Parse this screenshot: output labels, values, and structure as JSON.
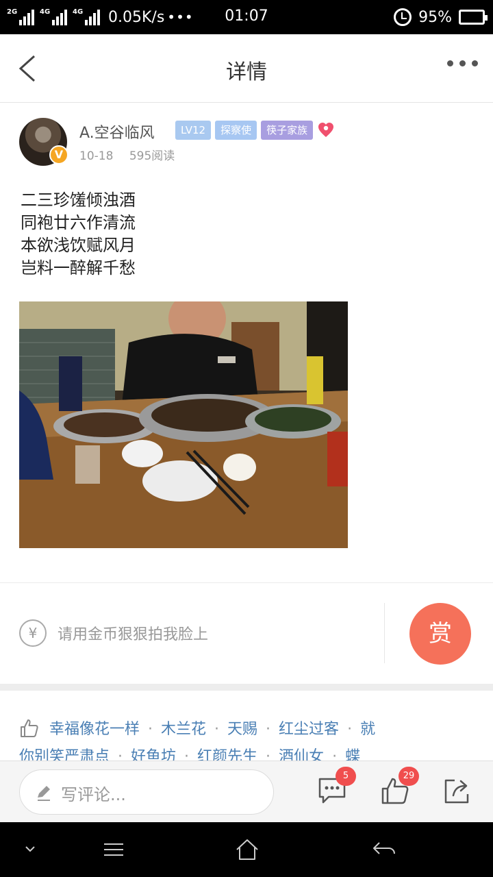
{
  "status_bar": {
    "net1": "2G",
    "net2": "4G",
    "net3": "4G",
    "speed": "0.05K/s",
    "dots": "•••",
    "time": "01:07",
    "battery": "95%"
  },
  "nav": {
    "title": "详情"
  },
  "post": {
    "author": "A.空谷临风",
    "author_badge": "V",
    "tags": [
      "LV12",
      "探察使",
      "筷子家族"
    ],
    "date": "10-18",
    "reads": "595阅读",
    "poem": [
      "二三珍馐倾浊酒",
      "同袍廿六作清流",
      "本欲浅饮赋风月",
      "岂料一醉解千愁"
    ]
  },
  "reward": {
    "yen_symbol": "¥",
    "prompt": "请用金币狠狠拍我脸上",
    "button": "赏"
  },
  "likes": {
    "line1": [
      "幸福像花一样",
      "木兰花",
      "天赐",
      "红尘过客",
      "就"
    ],
    "line2": [
      "你别笑严肃点",
      "好鱼坊",
      "红颜先生",
      "酒仙女",
      "蝶"
    ],
    "separator": "·"
  },
  "comment_bar": {
    "placeholder": "写评论...",
    "comment_count": "5",
    "like_count": "29"
  },
  "icons": {
    "back": "back-arrow-icon",
    "more": "more-dots-icon",
    "like": "thumbs-up-icon",
    "comment": "comment-icon",
    "share": "share-icon",
    "edit": "pen-icon"
  },
  "colors": {
    "accent": "#f5715a",
    "link": "#4a7fb4",
    "badge_red": "#f04e4e",
    "vip_orange": "#f5a623"
  }
}
